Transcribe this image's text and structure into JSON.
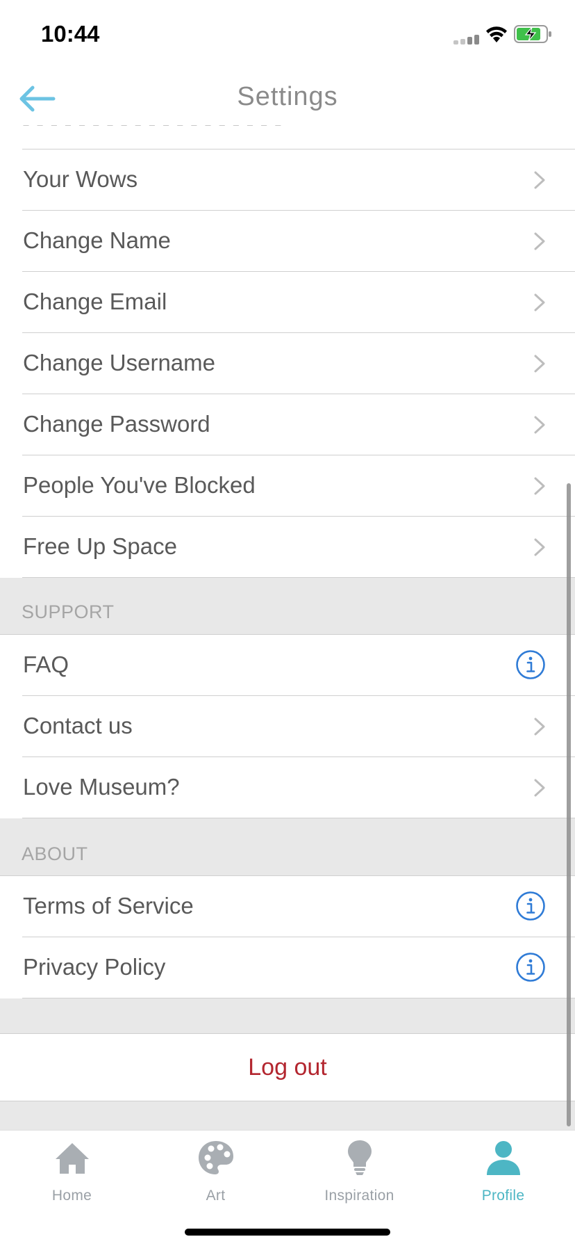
{
  "status_bar": {
    "time": "10:44"
  },
  "nav": {
    "title": "Settings",
    "back_icon": "arrow-left-icon"
  },
  "account_rows": [
    {
      "label": "Your Wows",
      "accessory": "chevron"
    },
    {
      "label": "Change Name",
      "accessory": "chevron"
    },
    {
      "label": "Change Email",
      "accessory": "chevron"
    },
    {
      "label": "Change Username",
      "accessory": "chevron"
    },
    {
      "label": "Change Password",
      "accessory": "chevron"
    },
    {
      "label": "People You've Blocked",
      "accessory": "chevron"
    },
    {
      "label": "Free Up Space",
      "accessory": "chevron"
    }
  ],
  "support": {
    "header": "SUPPORT",
    "rows": [
      {
        "label": "FAQ",
        "accessory": "info"
      },
      {
        "label": "Contact us",
        "accessory": "chevron"
      },
      {
        "label": "Love Museum?",
        "accessory": "chevron"
      }
    ]
  },
  "about": {
    "header": "ABOUT",
    "rows": [
      {
        "label": "Terms of Service",
        "accessory": "info"
      },
      {
        "label": "Privacy Policy",
        "accessory": "info"
      }
    ]
  },
  "logout": {
    "label": "Log out"
  },
  "tabs": [
    {
      "label": "Home",
      "icon": "home-icon",
      "active": false
    },
    {
      "label": "Art",
      "icon": "palette-icon",
      "active": false
    },
    {
      "label": "Inspiration",
      "icon": "lightbulb-icon",
      "active": false
    },
    {
      "label": "Profile",
      "icon": "person-icon",
      "active": true
    }
  ],
  "colors": {
    "accent": "#4db6c4",
    "back_arrow": "#6cc3e3",
    "info_icon": "#2f7bd6",
    "logout_text": "#b3262f",
    "inactive_tab": "#9aa0a6",
    "section_bg": "#e8e8e8"
  }
}
